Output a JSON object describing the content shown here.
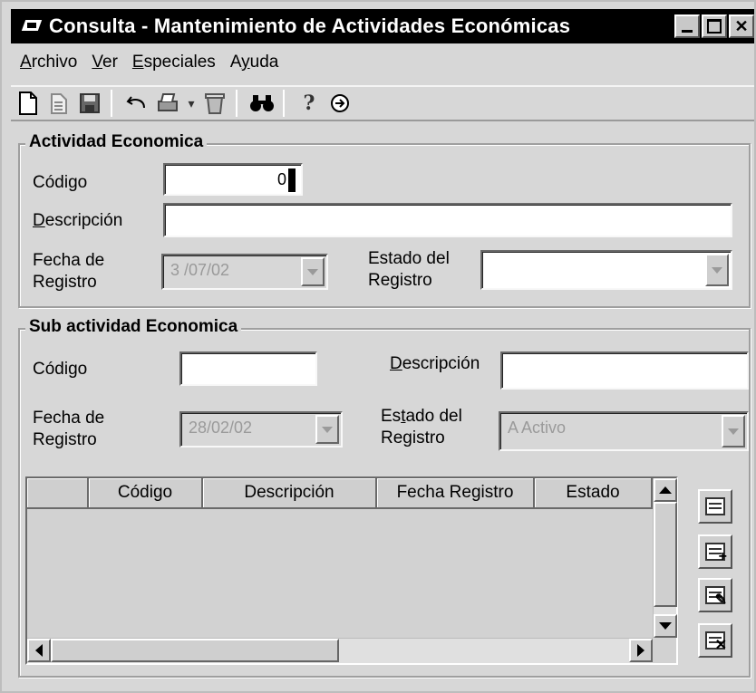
{
  "window": {
    "title": "Consulta - Mantenimiento de Actividades Económicas"
  },
  "menu": {
    "items": [
      {
        "label": "Archivo",
        "accel_index": 0
      },
      {
        "label": "Ver",
        "accel_index": 0
      },
      {
        "label": "Especiales",
        "accel_index": 0
      },
      {
        "label": "Ayuda",
        "accel_index": 1
      }
    ]
  },
  "toolbar": {
    "icons": [
      "new-document-icon",
      "copy-document-icon",
      "save-icon",
      "undo-icon",
      "print-icon",
      "dropdown-arrow-icon",
      "recycle-icon",
      "binoculars-search-icon",
      "help-icon",
      "exit-arrow-icon"
    ]
  },
  "actividad": {
    "group_title": "Actividad Economica",
    "codigo_label": "Código",
    "codigo_value": "0",
    "descripcion_label": "Descripción",
    "descripcion_value": "",
    "fecha_label_1": "Fecha de",
    "fecha_label_2": "Registro",
    "fecha_value": "3 /07/02",
    "estado_label_1": "Estado del",
    "estado_label_2": "Registro",
    "estado_value": ""
  },
  "subactividad": {
    "group_title": "Sub actividad Economica",
    "codigo_label": "Código",
    "codigo_value": "",
    "descripcion_label": "Descripción",
    "descripcion_value": "",
    "fecha_label_1": "Fecha de",
    "fecha_label_2": "Registro",
    "fecha_value": "28/02/02",
    "estado_label_1": "Estado del",
    "estado_label_2": "Registro",
    "estado_value": "A Activo"
  },
  "grid": {
    "columns": [
      "",
      "Código",
      "Descripción",
      "Fecha Registro",
      "Estado"
    ],
    "rows": []
  },
  "side_buttons": [
    "view-record-icon",
    "add-record-icon",
    "edit-record-icon",
    "delete-record-icon"
  ]
}
